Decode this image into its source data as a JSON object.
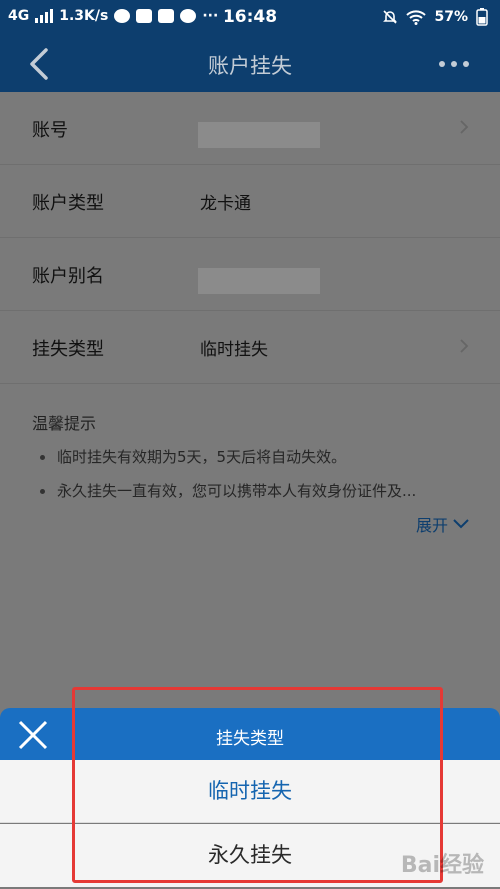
{
  "status_bar": {
    "network": "4G",
    "speed": "1.3K/s",
    "dots": "···",
    "time": "16:48",
    "battery": "57%"
  },
  "nav": {
    "title": "账户挂失"
  },
  "form": {
    "rows": [
      {
        "label": "账号",
        "value": ""
      },
      {
        "label": "账户类型",
        "value": "龙卡通"
      },
      {
        "label": "账户别名",
        "value": ""
      },
      {
        "label": "挂失类型",
        "value": "临时挂失"
      }
    ]
  },
  "hint": {
    "title": "温馨提示",
    "items": [
      "临时挂失有效期为5天，5天后将自动失效。",
      "永久挂失一直有效，您可以携带本人有效身份证件及..."
    ],
    "expand_label": "展开"
  },
  "sheet": {
    "title": "挂失类型",
    "options": [
      "临时挂失",
      "永久挂失"
    ]
  },
  "watermark": "Bai经验",
  "colors": {
    "nav_bg": "#0d3e6e",
    "sheet_header": "#1a6fc2",
    "highlight_box": "#e53935",
    "selected_option": "#1565b0"
  }
}
